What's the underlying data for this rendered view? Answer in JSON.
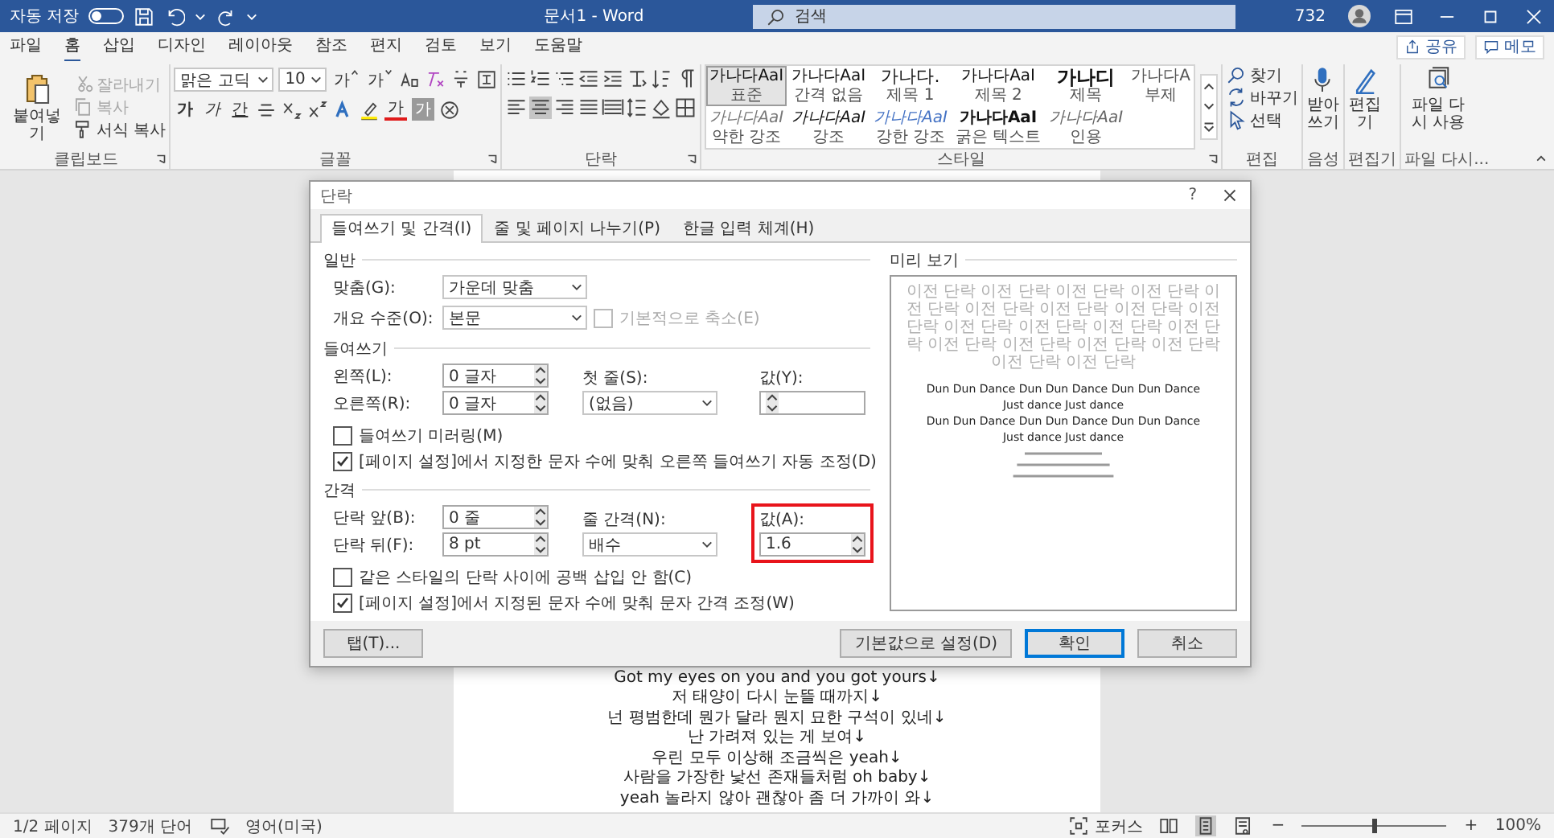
{
  "title_bar": {
    "autosave_label": "자동 저장",
    "autosave_on": false,
    "document_title": "문서1 - Word",
    "search_placeholder": "검색",
    "counter": "732"
  },
  "menu_tabs": [
    {
      "label": "파일",
      "selected": false
    },
    {
      "label": "홈",
      "selected": true
    },
    {
      "label": "삽입",
      "selected": false
    },
    {
      "label": "디자인",
      "selected": false
    },
    {
      "label": "레이아웃",
      "selected": false
    },
    {
      "label": "참조",
      "selected": false
    },
    {
      "label": "편지",
      "selected": false
    },
    {
      "label": "검토",
      "selected": false
    },
    {
      "label": "보기",
      "selected": false
    },
    {
      "label": "도움말",
      "selected": false
    }
  ],
  "share_button": "공유",
  "comments_button": "메모",
  "ribbon": {
    "clipboard": {
      "label": "클립보드",
      "paste": "붙여넣기",
      "actions": [
        {
          "kind": "cut",
          "label": "잘라내기",
          "disabled": true
        },
        {
          "kind": "copy",
          "label": "복사",
          "disabled": true
        },
        {
          "kind": "format_painter",
          "label": "서식 복사",
          "disabled": false
        }
      ]
    },
    "font": {
      "label": "글꼴",
      "name": "맑은 고딕",
      "size": "10",
      "size_buttons": [
        {
          "kind": "grow",
          "glyph": "가"
        },
        {
          "kind": "shrink",
          "glyph": "가"
        }
      ],
      "styles": [
        {
          "kind": "bold",
          "glyph": "가"
        },
        {
          "kind": "italic",
          "glyph": "가"
        },
        {
          "kind": "underline",
          "glyph": "간"
        }
      ],
      "color_glyph": "가",
      "shading_glyph": "가"
    },
    "paragraph": {
      "label": "단락",
      "alignments": [
        {
          "kind": "left",
          "selected": false
        },
        {
          "kind": "center",
          "selected": true
        },
        {
          "kind": "right",
          "selected": false
        },
        {
          "kind": "justify",
          "selected": false
        },
        {
          "kind": "distributed",
          "selected": false
        }
      ]
    },
    "styles": {
      "label": "스타일",
      "items": [
        {
          "kind": "normal",
          "sample": "가나다AaI",
          "name": "표준",
          "selected": true
        },
        {
          "kind": "normal",
          "sample": "가나다AaI",
          "name": "간격 없음",
          "selected": false
        },
        {
          "kind": "heading1",
          "sample": "가나다.",
          "name": "제목 1",
          "selected": false
        },
        {
          "kind": "heading2",
          "sample": "가나다AaI",
          "name": "제목 2",
          "selected": false
        },
        {
          "kind": "title",
          "sample": "가나디",
          "name": "제목",
          "selected": false
        },
        {
          "kind": "subtitle",
          "sample": "가나다A",
          "name": "부제",
          "selected": false
        },
        {
          "kind": "subtle",
          "sample": "가나다AaI",
          "name": "약한 강조",
          "selected": false
        },
        {
          "kind": "emphasis",
          "sample": "가나다AaI",
          "name": "강조",
          "selected": false
        },
        {
          "kind": "intense",
          "sample": "가나다AaI",
          "name": "강한 강조",
          "selected": false
        },
        {
          "kind": "strong",
          "sample": "가나다AaI",
          "name": "굵은 텍스트",
          "selected": false
        },
        {
          "kind": "quote",
          "sample": "가나다AaI",
          "name": "인용",
          "selected": false
        }
      ]
    },
    "editing": {
      "label": "편집",
      "items": [
        {
          "kind": "find",
          "label": "찾기"
        },
        {
          "kind": "replace",
          "label": "바꾸기"
        },
        {
          "kind": "select",
          "label": "선택"
        }
      ]
    },
    "voice": {
      "label": "음성",
      "button": "받아쓰기"
    },
    "editor": {
      "label": "편집기",
      "button": "편집기"
    },
    "reuse": {
      "label": "파일 다시...",
      "button": "파일 다시 사용"
    }
  },
  "dialog": {
    "title": "단락",
    "help": "?",
    "tabs": [
      {
        "label": "들여쓰기 및 간격(I)",
        "selected": true
      },
      {
        "label": "줄 및 페이지 나누기(P)",
        "selected": false
      },
      {
        "label": "한글 입력 체계(H)",
        "selected": false
      }
    ],
    "general": {
      "heading": "일반",
      "alignment_label": "맞춤(G):",
      "alignment_value": "가운데 맞춤",
      "outline_label": "개요 수준(O):",
      "outline_value": "본문",
      "collapse_label": "기본적으로 축소(E)",
      "collapse_checked": false,
      "collapse_disabled": true
    },
    "indent": {
      "heading": "들여쓰기",
      "left_label": "왼쪽(L):",
      "left_value": "0 글자",
      "right_label": "오른쪽(R):",
      "right_value": "0 글자",
      "first_label": "첫 줄(S):",
      "first_value": "(없음)",
      "by_label": "값(Y):",
      "mirror_label": "들여쓰기 미러링(M)",
      "mirror_checked": false,
      "auto_label": "[페이지 설정]에서 지정한 문자 수에 맞춰 오른쪽 들여쓰기 자동 조정(D)",
      "auto_checked": true
    },
    "spacing": {
      "heading": "간격",
      "before_label": "단락 앞(B):",
      "before_value": "0 줄",
      "after_label": "단락 뒤(F):",
      "after_value": "8 pt",
      "line_label": "줄 간격(N):",
      "line_value": "배수",
      "at_label": "값(A):",
      "at_value": "1.6",
      "at_highlighted": true,
      "no_space_label": "같은 스타일의 단락 사이에 공백 삽입 안 함(C)",
      "no_space_checked": false,
      "grid_label": "[페이지 설정]에서 지정된 문자 수에 맞춰 문자 간격 조정(W)",
      "grid_checked": true
    },
    "preview": {
      "heading": "미리 보기",
      "previous_text": "이전 단락 이전 단락 이전 단락 이전 단락 이전 단락 이전 단락 이전 단락 이전 단락 이전 단락 이전 단락 이전 단락 이전 단락 이전 단락 이전 단락 이전 단락 이전 단락 이전 단락 이전 단락 이전 단락",
      "sample_lines": [
        "Dun Dun Dance Dun Dun Dance Dun Dun Dance",
        "Just dance Just dance",
        "Dun Dun Dance Dun Dun Dance Dun Dun Dance",
        "Just dance Just dance"
      ]
    },
    "buttons": [
      {
        "label": "탭(T)...",
        "primary": false
      },
      {
        "label": "기본값으로 설정(D)",
        "primary": false
      },
      {
        "label": "확인",
        "primary": true
      },
      {
        "label": "취소",
        "primary": false
      }
    ]
  },
  "document": {
    "lines": [
      "Got my eyes on you and you got yours↓",
      "저 태양이 다시 눈뜰 때까지↓",
      "넌 평범한데 뭔가 달라 뭔지 묘한 구석이 있네↓",
      "난 가려져 있는 게 보여↓",
      "우린 모두 이상해 조금씩은 yeah↓",
      "사람을 가장한 낯선 존재들처럼 oh baby↓",
      "yeah 놀라지 않아 괜찮아 좀 더 가까이 와↓"
    ]
  },
  "status_bar": {
    "page": "1/2 페이지",
    "words": "379개 단어",
    "language": "영어(미국)",
    "focus": "포커스",
    "views": [
      {
        "kind": "read",
        "selected": false
      },
      {
        "kind": "print",
        "selected": true
      },
      {
        "kind": "web",
        "selected": false
      }
    ],
    "zoom_out": "−",
    "zoom_in": "+",
    "zoom": {
      "level": 0.5,
      "reading": "100%"
    }
  }
}
